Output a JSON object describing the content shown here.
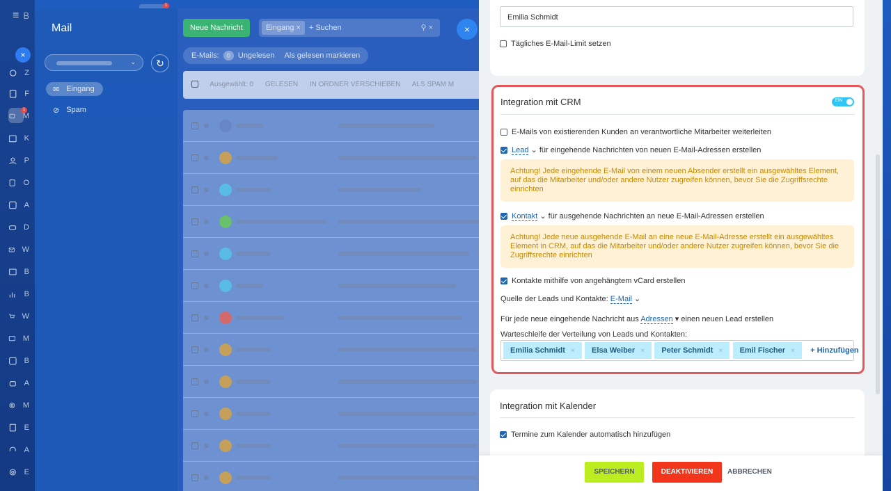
{
  "colors": {
    "accent": "#2067b0",
    "toggle": "#2fc6f6",
    "save": "#bbed21",
    "deactivate": "#f1361b",
    "warning_bg": "#fff1d6",
    "warning_text": "#c58a00",
    "highlight_border": "#e3585d"
  },
  "rail": {
    "items": [
      "Z",
      "F",
      "M",
      "K",
      "P",
      "O",
      "A",
      "D",
      "W",
      "B",
      "B",
      "W",
      "M",
      "B",
      "A",
      "M",
      "E",
      "A",
      "E"
    ],
    "logo_letter": "B",
    "badges": [
      "1",
      "1"
    ]
  },
  "mail": {
    "title": "Mail",
    "new_button": "Neue Nachricht",
    "search_chip": "Eingang",
    "search_placeholder": "+ Suchen",
    "counter_label": "E-Mails:",
    "counter_value": "0",
    "counter_unread": "Ungelesen",
    "mark_read": "Als gelesen markieren",
    "folders": {
      "inbox": "Eingang",
      "spam": "Spam"
    },
    "toolbar": {
      "selected": "Ausgewählt: 0",
      "read": "GELESEN",
      "move": "IN ORDNER VERSCHIEBEN",
      "spam": "ALS SPAM M"
    }
  },
  "form": {
    "name_value": "Emilia Schmidt",
    "daily_limit": "Tägliches E-Mail-Limit setzen",
    "crm": {
      "title": "Integration mit CRM",
      "toggle_label": "EIN",
      "forward": "E-Mails von existierenden Kunden an verantwortliche Mitarbeiter weiterleiten",
      "lead_dd": "Lead",
      "lead_text": "für eingehende Nachrichten von neuen E-Mail-Adressen erstellen",
      "lead_warning": "Achtung! Jede eingehende E-Mail von einem neuen Absender erstellt ein ausgewähltes Element, auf das die Mitarbeiter und/oder andere Nutzer zugreifen können, bevor Sie die Zugriffsrechte einrichten",
      "contact_dd": "Kontakt",
      "contact_text": "für ausgehende Nachrichten an neue E-Mail-Adressen erstellen",
      "contact_warning": "Achtung! Jede neue ausgehende E-Mail an eine neue E-Mail-Adresse erstellt ein ausgewähltes Element in CRM, auf das die Mitarbeiter und/oder andere Nutzer zugreifen können, bevor Sie die Zugriffsrechte einrichten",
      "vcard": "Kontakte mithilfe von angehängtem vCard erstellen",
      "source_label": "Quelle der Leads und Kontakte:",
      "source_value": "E-Mail",
      "each_prefix": "Für jede neue eingehende Nachricht aus",
      "each_dd": "Adressen",
      "each_suffix": "einen neuen Lead erstellen",
      "queue_label": "Warteschleife der Verteilung von Leads und Kontakten:",
      "queue": [
        "Emilia Schmidt",
        "Elsa Weiber",
        "Peter Schmidt",
        "Emil Fischer"
      ],
      "add": "+ Hinzufügen"
    },
    "calendar": {
      "title": "Integration mit Kalender",
      "auto_add": "Termine zum Kalender automatisch hinzufügen"
    },
    "buttons": {
      "save": "SPEICHERN",
      "deactivate": "DEAKTIVIEREN",
      "cancel": "ABBRECHEN"
    }
  }
}
